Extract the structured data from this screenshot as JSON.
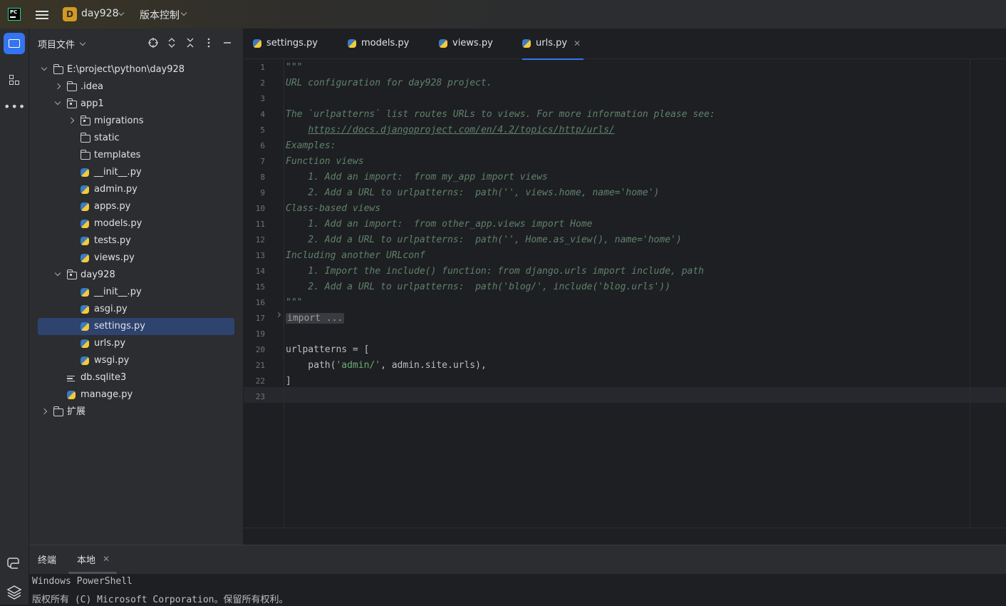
{
  "titlebar": {
    "project_badge": "D",
    "project_name": "day928",
    "vcs_label": "版本控制"
  },
  "project_panel": {
    "title": "项目文件",
    "tree": [
      {
        "label": "E:\\project\\python\\day928",
        "depth": 0,
        "icon": "folder-icon",
        "arrow": "open"
      },
      {
        "label": ".idea",
        "depth": 1,
        "icon": "folder-icon",
        "arrow": "closed"
      },
      {
        "label": "app1",
        "depth": 1,
        "icon": "package-folder-icon",
        "arrow": "open"
      },
      {
        "label": "migrations",
        "depth": 2,
        "icon": "package-folder-icon",
        "arrow": "closed"
      },
      {
        "label": "static",
        "depth": 2,
        "icon": "folder-icon",
        "arrow": "none"
      },
      {
        "label": "templates",
        "depth": 2,
        "icon": "folder-icon",
        "arrow": "none"
      },
      {
        "label": "__init__.py",
        "depth": 2,
        "icon": "python-file-icon",
        "arrow": "none"
      },
      {
        "label": "admin.py",
        "depth": 2,
        "icon": "python-file-icon",
        "arrow": "none"
      },
      {
        "label": "apps.py",
        "depth": 2,
        "icon": "python-file-icon",
        "arrow": "none"
      },
      {
        "label": "models.py",
        "depth": 2,
        "icon": "python-file-icon",
        "arrow": "none"
      },
      {
        "label": "tests.py",
        "depth": 2,
        "icon": "python-file-icon",
        "arrow": "none"
      },
      {
        "label": "views.py",
        "depth": 2,
        "icon": "python-file-icon",
        "arrow": "none"
      },
      {
        "label": "day928",
        "depth": 1,
        "icon": "package-folder-icon",
        "arrow": "open"
      },
      {
        "label": "__init__.py",
        "depth": 2,
        "icon": "python-file-icon",
        "arrow": "none"
      },
      {
        "label": "asgi.py",
        "depth": 2,
        "icon": "python-file-icon",
        "arrow": "none"
      },
      {
        "label": "settings.py",
        "depth": 2,
        "icon": "python-file-icon",
        "arrow": "none",
        "selected": true
      },
      {
        "label": "urls.py",
        "depth": 2,
        "icon": "python-file-icon",
        "arrow": "none"
      },
      {
        "label": "wsgi.py",
        "depth": 2,
        "icon": "python-file-icon",
        "arrow": "none"
      },
      {
        "label": "db.sqlite3",
        "depth": 1,
        "icon": "database-file-icon",
        "arrow": "none"
      },
      {
        "label": "manage.py",
        "depth": 1,
        "icon": "python-file-icon",
        "arrow": "none"
      },
      {
        "label": "扩展",
        "depth": 0,
        "icon": "folder-icon",
        "arrow": "closed"
      }
    ]
  },
  "editor": {
    "tabs": [
      {
        "label": "settings.py",
        "active": false
      },
      {
        "label": "models.py",
        "active": false
      },
      {
        "label": "views.py",
        "active": false
      },
      {
        "label": "urls.py",
        "active": true
      }
    ],
    "lines": [
      {
        "n": "1",
        "text": "\"\"\"",
        "style": "doc"
      },
      {
        "n": "2",
        "text": "URL configuration for day928 project.",
        "style": "doc"
      },
      {
        "n": "3",
        "text": "",
        "style": "doc"
      },
      {
        "n": "4",
        "text": "The `urlpatterns` list routes URLs to views. For more information please see:",
        "style": "doc"
      },
      {
        "n": "5",
        "text": "    https://docs.djangoproject.com/en/4.2/topics/http/urls/",
        "style": "doc-link"
      },
      {
        "n": "6",
        "text": "Examples:",
        "style": "doc"
      },
      {
        "n": "7",
        "text": "Function views",
        "style": "doc"
      },
      {
        "n": "8",
        "text": "    1. Add an import:  from my_app import views",
        "style": "doc"
      },
      {
        "n": "9",
        "text": "    2. Add a URL to urlpatterns:  path('', views.home, name='home')",
        "style": "doc"
      },
      {
        "n": "10",
        "text": "Class-based views",
        "style": "doc"
      },
      {
        "n": "11",
        "text": "    1. Add an import:  from other_app.views import Home",
        "style": "doc"
      },
      {
        "n": "12",
        "text": "    2. Add a URL to urlpatterns:  path('', Home.as_view(), name='home')",
        "style": "doc"
      },
      {
        "n": "13",
        "text": "Including another URLconf",
        "style": "doc"
      },
      {
        "n": "14",
        "text": "    1. Import the include() function: from django.urls import include, path",
        "style": "doc"
      },
      {
        "n": "15",
        "text": "    2. Add a URL to urlpatterns:  path('blog/', include('blog.urls'))",
        "style": "doc"
      },
      {
        "n": "16",
        "text": "\"\"\"",
        "style": "doc"
      },
      {
        "n": "17",
        "text": "import ...",
        "style": "fold"
      },
      {
        "n": "19",
        "text": "",
        "style": "normal"
      },
      {
        "n": "20",
        "text": "urlpatterns = [",
        "style": "normal"
      },
      {
        "n": "21",
        "text": "    path('admin/', admin.site.urls),",
        "style": "code-str"
      },
      {
        "n": "22",
        "text": "]",
        "style": "normal"
      },
      {
        "n": "23",
        "text": "",
        "style": "normal"
      }
    ]
  },
  "terminal": {
    "title": "终端",
    "tab_label": "本地",
    "lines": [
      "Windows PowerShell",
      "版权所有 (C) Microsoft Corporation。保留所有权利。"
    ]
  }
}
